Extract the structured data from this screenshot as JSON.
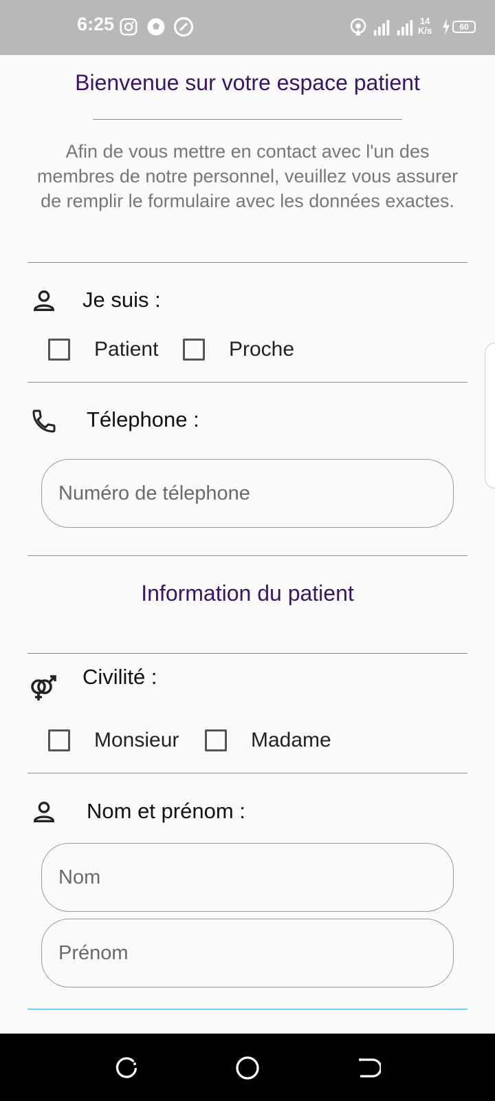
{
  "status_bar": {
    "time": "6:25",
    "network_speed": "14",
    "network_unit": "K/s",
    "network_type": "4G",
    "battery": "60"
  },
  "header": {
    "title": "Bienvenue sur votre espace patient",
    "intro": "Afin de vous mettre en contact avec l'un des membres de notre personnel, veuillez vous assurer de remplir le formulaire avec les données exactes."
  },
  "je_suis": {
    "label": "Je suis :",
    "options": [
      "Patient",
      "Proche"
    ]
  },
  "telephone": {
    "label": "Télephone :",
    "placeholder": "Numéro de télephone",
    "value": ""
  },
  "patient_section": {
    "title": "Information du patient"
  },
  "civilite": {
    "label": "Civilité :",
    "options": [
      "Monsieur",
      "Madame"
    ]
  },
  "nom_prenom": {
    "label": "Nom et prénom :",
    "nom_placeholder": "Nom",
    "prenom_placeholder": "Prénom"
  },
  "icons": {
    "person": "person-outline-icon",
    "phone": "phone-icon",
    "gender": "gender-icon"
  },
  "colors": {
    "title": "#3a1466",
    "rule": "#42a5e0",
    "status_bar": "#b8b8b8",
    "nav_bar": "#000000"
  }
}
